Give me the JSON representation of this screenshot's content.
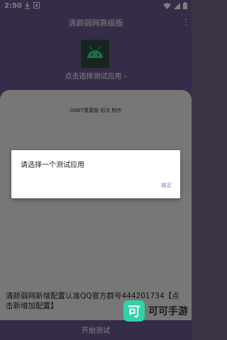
{
  "status_bar": {
    "time": "2:50"
  },
  "app_bar": {
    "title": "清颜弱网高级版",
    "overflow": "⋮"
  },
  "app_picker": {
    "label": "点击选择测试应用 ›"
  },
  "sheet": {
    "header": "QNET重要版 初次 制作"
  },
  "bottom_note": {
    "text": "清颜弱网新增配置认准QQ官方群号444201734【点击新增加配置】"
  },
  "bottom_bar": {
    "start_label": "开始测试"
  },
  "dialog": {
    "message": "请选择一个测试应用",
    "ok_label": "确定"
  },
  "watermark": {
    "logo_char": "可",
    "text": "可可手游"
  },
  "colors": {
    "primary": "#6b5a8e",
    "accent": "#9c7bd6",
    "android_green": "#3ddc84"
  }
}
